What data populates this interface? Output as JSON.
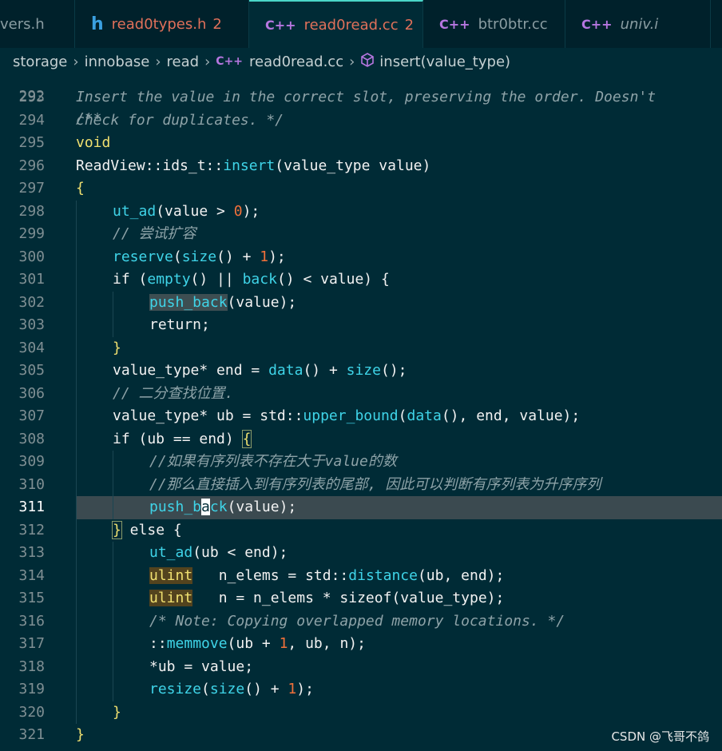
{
  "tabs": [
    {
      "icon": "",
      "label": "vers.h",
      "badge": "",
      "active": false,
      "color": "#8a9da2"
    },
    {
      "icon": "h",
      "label": "read0types.h",
      "badge": "2",
      "active": false,
      "color": "#e0705a"
    },
    {
      "icon": "C++",
      "label": "read0read.cc",
      "badge": "2",
      "active": true,
      "color": "#e0705a"
    },
    {
      "icon": "C++",
      "label": "btr0btr.cc",
      "badge": "",
      "active": false,
      "color": "#8a9da2"
    },
    {
      "icon": "C++",
      "label": "univ.i",
      "badge": "",
      "active": false,
      "color": "#8a9da2"
    }
  ],
  "breadcrumb": {
    "parts": [
      "storage",
      "innobase",
      "read"
    ],
    "file_icon": "C++",
    "file": "read0read.cc",
    "symbol": "insert(value_type)"
  },
  "editor": {
    "partial_top_line": {
      "number": "292",
      "text": "/**"
    },
    "lines": [
      {
        "n": "293",
        "indent": 0,
        "tokens": [
          [
            "cm",
            "Insert the value in the correct slot, preserving the order. Doesn't"
          ]
        ]
      },
      {
        "n": "294",
        "indent": 0,
        "tokens": [
          [
            "cm",
            "check for duplicates. */"
          ]
        ]
      },
      {
        "n": "295",
        "indent": 0,
        "tokens": [
          [
            "kw",
            "void"
          ]
        ]
      },
      {
        "n": "296",
        "indent": 0,
        "tokens": [
          [
            "tx",
            "ReadView::ids_t::"
          ],
          [
            "fn",
            "insert"
          ],
          [
            "tx",
            "(value_type value)"
          ]
        ]
      },
      {
        "n": "297",
        "indent": 0,
        "tokens": [
          [
            "kw",
            "{"
          ]
        ]
      },
      {
        "n": "298",
        "indent": 1,
        "tokens": [
          [
            "fn",
            "ut_ad"
          ],
          [
            "tx",
            "(value > "
          ],
          [
            "num",
            "0"
          ],
          [
            "tx",
            ");"
          ]
        ]
      },
      {
        "n": "299",
        "indent": 1,
        "tokens": [
          [
            "cm",
            "// 尝试扩容"
          ]
        ]
      },
      {
        "n": "300",
        "indent": 1,
        "tokens": [
          [
            "fn",
            "reserve"
          ],
          [
            "tx",
            "("
          ],
          [
            "fn",
            "size"
          ],
          [
            "tx",
            "() + "
          ],
          [
            "num",
            "1"
          ],
          [
            "tx",
            ");"
          ]
        ]
      },
      {
        "n": "301",
        "indent": 1,
        "tokens": [
          [
            "tx",
            "if ("
          ],
          [
            "fn",
            "empty"
          ],
          [
            "tx",
            "() || "
          ],
          [
            "fn",
            "back"
          ],
          [
            "tx",
            "() < value) {"
          ]
        ]
      },
      {
        "n": "302",
        "indent": 2,
        "tokens": [
          [
            "fnhl",
            "push_back"
          ],
          [
            "tx",
            "(value);"
          ]
        ]
      },
      {
        "n": "303",
        "indent": 2,
        "tokens": [
          [
            "tx",
            "return;"
          ]
        ]
      },
      {
        "n": "304",
        "indent": 1,
        "tokens": [
          [
            "kw",
            "}"
          ]
        ]
      },
      {
        "n": "305",
        "indent": 1,
        "tokens": [
          [
            "tx",
            "value_type* end = "
          ],
          [
            "fn",
            "data"
          ],
          [
            "tx",
            "() + "
          ],
          [
            "fn",
            "size"
          ],
          [
            "tx",
            "();"
          ]
        ]
      },
      {
        "n": "306",
        "indent": 1,
        "tokens": [
          [
            "cm",
            "// 二分查找位置."
          ]
        ]
      },
      {
        "n": "307",
        "indent": 1,
        "tokens": [
          [
            "tx",
            "value_type* ub = std::"
          ],
          [
            "fn",
            "upper_bound"
          ],
          [
            "tx",
            "("
          ],
          [
            "fn",
            "data"
          ],
          [
            "tx",
            "(), end, value);"
          ]
        ]
      },
      {
        "n": "308",
        "indent": 1,
        "tokens": [
          [
            "tx",
            "if (ub == end) "
          ],
          [
            "kwbox",
            "{"
          ]
        ]
      },
      {
        "n": "309",
        "indent": 2,
        "tokens": [
          [
            "cm",
            "//如果有序列表不存在大于value的数"
          ]
        ]
      },
      {
        "n": "310",
        "indent": 2,
        "tokens": [
          [
            "cm",
            "//那么直接插入到有序列表的尾部, 因此可以判断有序列表为升序序列"
          ]
        ]
      },
      {
        "n": "311",
        "indent": 2,
        "current": true,
        "tokens": [
          [
            "fn",
            "push_b"
          ],
          [
            "cur",
            "a"
          ],
          [
            "fn",
            "ck"
          ],
          [
            "tx",
            "(value);"
          ]
        ]
      },
      {
        "n": "312",
        "indent": 1,
        "tokens": [
          [
            "kwbox",
            "}"
          ],
          [
            "tx",
            " else {"
          ]
        ]
      },
      {
        "n": "313",
        "indent": 2,
        "tokens": [
          [
            "fn",
            "ut_ad"
          ],
          [
            "tx",
            "(ub < end);"
          ]
        ]
      },
      {
        "n": "314",
        "indent": 2,
        "tokens": [
          [
            "tyhl",
            "ulint"
          ],
          [
            "tx",
            "   n_elems = std::"
          ],
          [
            "fn",
            "distance"
          ],
          [
            "tx",
            "(ub, end);"
          ]
        ]
      },
      {
        "n": "315",
        "indent": 2,
        "tokens": [
          [
            "tyhl",
            "ulint"
          ],
          [
            "tx",
            "   n = n_elems * "
          ],
          [
            "tx",
            "sizeof"
          ],
          [
            "tx",
            "(value_type);"
          ]
        ]
      },
      {
        "n": "316",
        "indent": 2,
        "tokens": [
          [
            "cm",
            "/* Note: Copying overlapped memory locations. */"
          ]
        ]
      },
      {
        "n": "317",
        "indent": 2,
        "tokens": [
          [
            "tx",
            "::"
          ],
          [
            "fn",
            "memmove"
          ],
          [
            "tx",
            "(ub + "
          ],
          [
            "num",
            "1"
          ],
          [
            "tx",
            ", ub, n);"
          ]
        ]
      },
      {
        "n": "318",
        "indent": 2,
        "tokens": [
          [
            "tx",
            "*ub = value;"
          ]
        ]
      },
      {
        "n": "319",
        "indent": 2,
        "tokens": [
          [
            "fn",
            "resize"
          ],
          [
            "tx",
            "("
          ],
          [
            "fn",
            "size"
          ],
          [
            "tx",
            "() + "
          ],
          [
            "num",
            "1"
          ],
          [
            "tx",
            ");"
          ]
        ]
      },
      {
        "n": "320",
        "indent": 1,
        "tokens": [
          [
            "kw",
            "}"
          ]
        ]
      },
      {
        "n": "321",
        "indent": 0,
        "tokens": [
          [
            "kw",
            "}"
          ]
        ]
      }
    ]
  },
  "watermark": "CSDN @飞哥不鸽",
  "colors": {
    "background": "#002b36",
    "keyword": "#f0e070",
    "function": "#3fd4e8",
    "comment": "#8ea3a8",
    "number": "#f0703a",
    "tab_accent": "#4ad6c8",
    "modified_tab": "#e0705a"
  }
}
